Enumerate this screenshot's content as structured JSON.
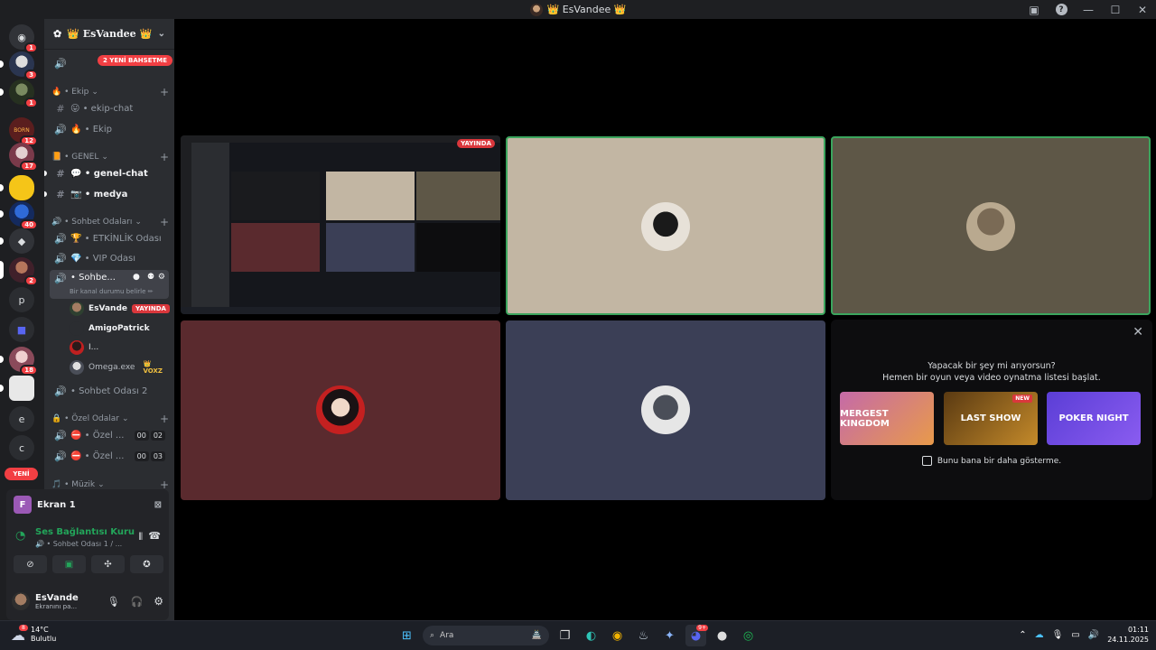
{
  "window": {
    "title": "👑 EsVandee 👑",
    "help": "?",
    "icons": [
      "inbox-icon",
      "help-icon",
      "minimize-icon",
      "maximize-icon",
      "close-icon"
    ]
  },
  "guilds": {
    "badges": [
      "1",
      "3",
      "1",
      "12",
      "17",
      "40",
      "2",
      "18"
    ],
    "letters": [
      "p",
      "e",
      "c"
    ],
    "new_label": "YENİ"
  },
  "server": {
    "name": "👑 EsVandee 👑",
    "mention_pill": "2 YENİ BAHSETME",
    "truncated_first": "e ...",
    "categories": {
      "ekip": "🔥 • Ekip",
      "genel": "📙 • GENEL",
      "sohbet": "🔊 • Sohbet Odaları",
      "ozel": "🔒 • Özel Odalar",
      "muzik": "🎵 • Müzik"
    },
    "channels": {
      "ekip_chat": "😛 • ekip-chat",
      "ekip_voice": "🔥 • Ekip",
      "genel_chat": "💬 • genel-chat",
      "medya": "📷 • medya",
      "etkinlik": "🏆 • ETKİNLİK Odası",
      "vip": "💎 • VIP Odası",
      "sohbet1": "• Sohbe...",
      "status_hint": "Bir kanal durumu belirle ✏",
      "sohbet2": "• Sohbet Odası 2",
      "ozel1": "⛔ • Özel ...",
      "ozel2": "⛔ • Özel ..."
    },
    "counters": {
      "ozel1_a": "00",
      "ozel1_b": "02",
      "ozel2_a": "00",
      "ozel2_b": "03"
    },
    "voice_users": [
      {
        "name": "EsVande",
        "tag": "YAYINDA"
      },
      {
        "name": "AmigoPatrick",
        "tag": ""
      },
      {
        "name": "I...",
        "tag": ""
      },
      {
        "name": "Omega.exe",
        "tag": "👑 VOXZ"
      }
    ]
  },
  "panel": {
    "screen_label": "Ekran 1",
    "f_letter": "F",
    "voice_status": "Ses Bağlantısı Kuru",
    "voice_channel": "🔊 • Sohbet Odası 1 / ...",
    "user_name": "EsVande",
    "user_status": "Ekranını pa..."
  },
  "stage": {
    "live_badge": "YAYINDA",
    "suggest": {
      "line1": "Yapacak bir şey mi arıyorsun?",
      "line2": "Hemen bir oyun veya video oynatma listesi başlat.",
      "games": [
        "MERGEST KINGDOM",
        "LAST SHOW",
        "POKER NIGHT"
      ],
      "new_tag": "NEW",
      "checkbox_label": "Bunu bana bir daha gösterme."
    }
  },
  "taskbar": {
    "temp": "14°C",
    "weather": "Bulutlu",
    "weather_badge": "8",
    "search_placeholder": "Ara",
    "discord_badge": "9+",
    "time": "01:11",
    "date": "24.11.2025"
  },
  "colors": {
    "discord_bg": "#1e1f22",
    "sidebar": "#2b2d31",
    "red_badge": "#f23f43",
    "green": "#23a55a",
    "tile_beige": "#c2b6a3",
    "tile_olive": "#5e5747",
    "tile_maroon": "#5a2a2e",
    "tile_slate": "#3b3f56"
  }
}
